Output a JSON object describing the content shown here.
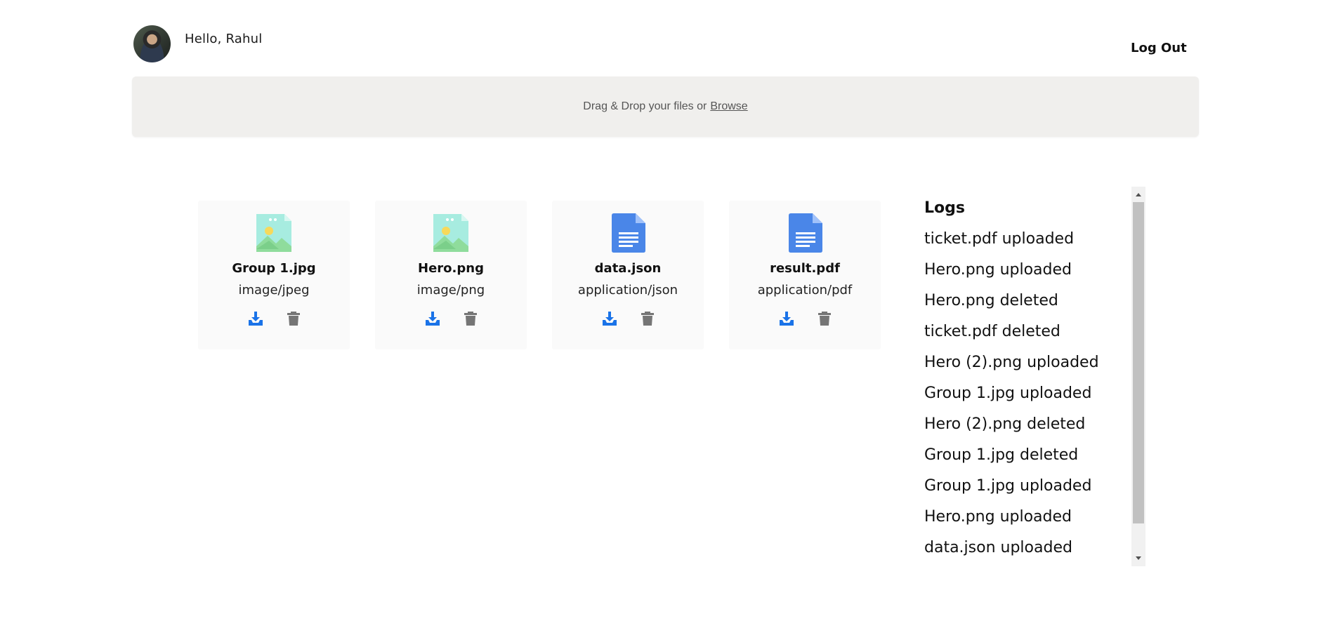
{
  "header": {
    "greeting": "Hello, Rahul",
    "logout_label": "Log Out"
  },
  "dropzone": {
    "text": "Drag & Drop your files or",
    "browse_label": "Browse"
  },
  "files": [
    {
      "name": "Group 1.jpg",
      "type": "image/jpeg",
      "icon": "image-file-icon"
    },
    {
      "name": "Hero.png",
      "type": "image/png",
      "icon": "image-file-icon"
    },
    {
      "name": "data.json",
      "type": "application/json",
      "icon": "document-file-icon"
    },
    {
      "name": "result.pdf",
      "type": "application/pdf",
      "icon": "document-file-icon"
    }
  ],
  "logs": {
    "title": "Logs",
    "entries": [
      "ticket.pdf uploaded",
      "Hero.png uploaded",
      "Hero.png deleted",
      "ticket.pdf deleted",
      "Hero (2).png uploaded",
      "Group 1.jpg uploaded",
      "Hero (2).png deleted",
      "Group 1.jpg deleted",
      "Group 1.jpg uploaded",
      "Hero.png uploaded",
      "data.json uploaded"
    ]
  },
  "colors": {
    "download_icon": "#1a73e8",
    "delete_icon": "#757575",
    "doc_icon": "#4a86e8",
    "image_icon_bg": "#a7ece0",
    "dropzone_bg": "#f0efed"
  }
}
